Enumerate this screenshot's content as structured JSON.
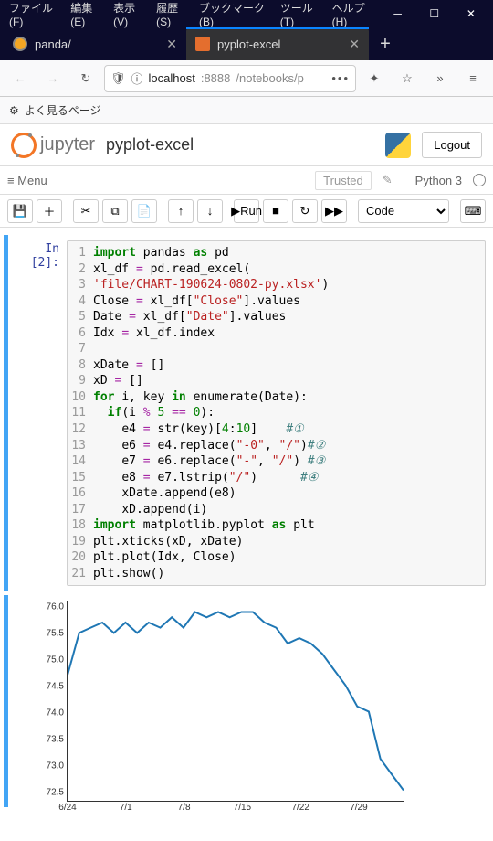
{
  "window": {
    "menus": [
      "ファイル(F)",
      "編集(E)",
      "表示(V)",
      "履歴(S)",
      "ブックマーク(B)",
      "ツール(T)",
      "ヘルプ(H)"
    ]
  },
  "tabs": [
    {
      "label": "panda/",
      "active": false
    },
    {
      "label": "pyplot-excel",
      "active": true
    }
  ],
  "url": {
    "proto": "localhost",
    "port": ":8888",
    "path": "/notebooks/p"
  },
  "bookmarks": {
    "label": "よく見るページ"
  },
  "jupyter": {
    "logo": "jupyter",
    "notebook": "pyplot-excel",
    "logout": "Logout",
    "menu_hamburger": "Menu",
    "trusted": "Trusted",
    "kernel": "Python 3",
    "celltype": "Code",
    "run": "Run"
  },
  "cell": {
    "prompt": "In [2]:",
    "lines": [
      {
        "n": 1,
        "html": "<span class='kw'>import</span> <span class='nm'>pandas</span> <span class='kw'>as</span> <span class='nm'>pd</span>"
      },
      {
        "n": 2,
        "html": "<span class='nm'>xl_df</span> <span class='op'>=</span> <span class='nm'>pd</span>.<span class='nm'>read_excel</span>("
      },
      {
        "n": 3,
        "html": "<span class='str'>'file/CHART-190624-0802-py.xlsx'</span>)"
      },
      {
        "n": 4,
        "html": "<span class='nm'>Close</span> <span class='op'>=</span> <span class='nm'>xl_df</span>[<span class='str'>\"Close\"</span>].<span class='nm'>values</span>"
      },
      {
        "n": 5,
        "html": "<span class='nm'>Date</span> <span class='op'>=</span> <span class='nm'>xl_df</span>[<span class='str'>\"Date\"</span>].<span class='nm'>values</span>"
      },
      {
        "n": 6,
        "html": "<span class='nm'>Idx</span> <span class='op'>=</span> <span class='nm'>xl_df</span>.<span class='nm'>index</span>"
      },
      {
        "n": 7,
        "html": ""
      },
      {
        "n": 8,
        "html": "<span class='nm'>xDate</span> <span class='op'>=</span> []"
      },
      {
        "n": 9,
        "html": "<span class='nm'>xD</span> <span class='op'>=</span> []"
      },
      {
        "n": 10,
        "html": "<span class='kw'>for</span> <span class='nm'>i</span>, <span class='nm'>key</span> <span class='kw'>in</span> <span class='nm'>enumerate</span>(<span class='nm'>Date</span>):"
      },
      {
        "n": 11,
        "html": "  <span class='kw'>if</span>(<span class='nm'>i</span> <span class='op'>%</span> <span class='num'>5</span> <span class='op'>==</span> <span class='num'>0</span>):"
      },
      {
        "n": 12,
        "html": "    <span class='nm'>e4</span> <span class='op'>=</span> <span class='nm'>str</span>(<span class='nm'>key</span>)[<span class='num'>4</span>:<span class='num'>10</span>]    <span class='cm'>#①</span>"
      },
      {
        "n": 13,
        "html": "    <span class='nm'>e6</span> <span class='op'>=</span> <span class='nm'>e4</span>.<span class='nm'>replace</span>(<span class='str'>\"-0\"</span>, <span class='str'>\"/\"</span>)<span class='cm'>#②</span>"
      },
      {
        "n": 14,
        "html": "    <span class='nm'>e7</span> <span class='op'>=</span> <span class='nm'>e6</span>.<span class='nm'>replace</span>(<span class='str'>\"-\"</span>, <span class='str'>\"/\"</span>) <span class='cm'>#③</span>"
      },
      {
        "n": 15,
        "html": "    <span class='nm'>e8</span> <span class='op'>=</span> <span class='nm'>e7</span>.<span class='nm'>lstrip</span>(<span class='str'>\"/\"</span>)      <span class='cm'>#④</span>"
      },
      {
        "n": 16,
        "html": "    <span class='nm'>xDate</span>.<span class='nm'>append</span>(<span class='nm'>e8</span>)"
      },
      {
        "n": 17,
        "html": "    <span class='nm'>xD</span>.<span class='nm'>append</span>(<span class='nm'>i</span>)"
      },
      {
        "n": 18,
        "html": "<span class='kw'>import</span> <span class='nm'>matplotlib</span>.<span class='nm'>pyplot</span> <span class='kw'>as</span> <span class='nm'>plt</span>"
      },
      {
        "n": 19,
        "html": "<span class='nm'>plt</span>.<span class='nm'>xticks</span>(<span class='nm'>xD</span>, <span class='nm'>xDate</span>)"
      },
      {
        "n": 20,
        "html": "<span class='nm'>plt</span>.<span class='nm'>plot</span>(<span class='nm'>Idx</span>, <span class='nm'>Close</span>)"
      },
      {
        "n": 21,
        "html": "<span class='nm'>plt</span>.<span class='nm'>show</span>()"
      }
    ]
  },
  "chart_data": {
    "type": "line",
    "x_ticks": [
      "6/24",
      "7/1",
      "7/8",
      "7/15",
      "7/22",
      "7/29"
    ],
    "y_ticks": [
      72.5,
      73.0,
      73.5,
      74.0,
      74.5,
      75.0,
      75.5,
      76.0
    ],
    "ylim": [
      72.3,
      76.1
    ],
    "xlim": [
      0,
      29
    ],
    "series": [
      {
        "name": "Close",
        "x": [
          0,
          1,
          2,
          3,
          4,
          5,
          6,
          7,
          8,
          9,
          10,
          11,
          12,
          13,
          14,
          15,
          16,
          17,
          18,
          19,
          20,
          21,
          22,
          23,
          24,
          25,
          26,
          27,
          28,
          29
        ],
        "y": [
          74.7,
          75.5,
          75.6,
          75.7,
          75.5,
          75.7,
          75.5,
          75.7,
          75.6,
          75.8,
          75.6,
          75.9,
          75.8,
          75.9,
          75.8,
          75.9,
          75.9,
          75.7,
          75.6,
          75.3,
          75.4,
          75.3,
          75.1,
          74.8,
          74.5,
          74.1,
          74.0,
          73.1,
          72.8,
          72.5
        ]
      }
    ]
  }
}
